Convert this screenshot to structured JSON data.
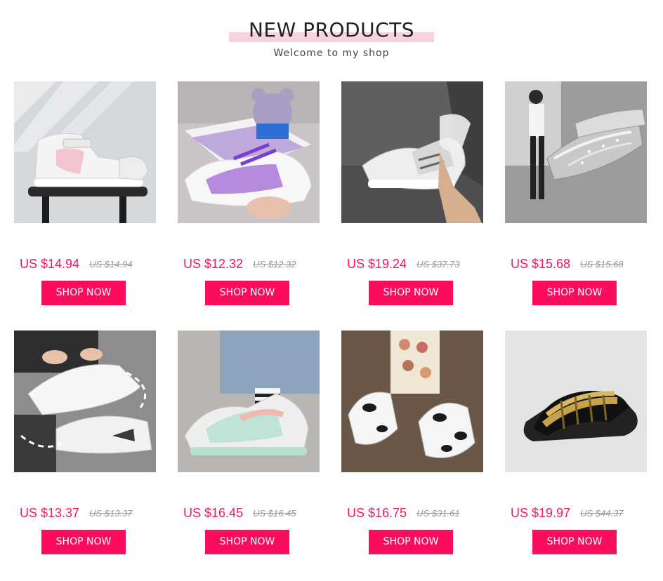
{
  "header": {
    "title": "NEW PRODUCTS",
    "subtitle": "Welcome to my shop"
  },
  "colors": {
    "price": "#ee1a5c",
    "button": "#fb0c5c",
    "title_highlight": "#f7d3e1"
  },
  "products": [
    {
      "image": "white-pink-high-top-sneaker",
      "price": "US $14.94",
      "old_price": "US $14.94",
      "button_label": "SHOP NOW"
    },
    {
      "image": "purple-painted-sneaker-with-plush-toy",
      "price": "US $12.32",
      "old_price": "US $12.32",
      "button_label": "SHOP NOW"
    },
    {
      "image": "white-reflective-sneaker",
      "price": "US $19.24",
      "old_price": "US $37.73",
      "button_label": "SHOP NOW"
    },
    {
      "image": "silver-glitter-sneaker",
      "price": "US $15.68",
      "old_price": "US $15.68",
      "button_label": "SHOP NOW"
    },
    {
      "image": "white-sneakers-in-hands",
      "price": "US $13.37",
      "old_price": "US $13.37",
      "button_label": "SHOP NOW"
    },
    {
      "image": "mint-pastel-sneaker",
      "price": "US $16.45",
      "old_price": "US $16.45",
      "button_label": "SHOP NOW"
    },
    {
      "image": "cow-print-sneakers",
      "price": "US $16.75",
      "old_price": "US $31.61",
      "button_label": "SHOP NOW"
    },
    {
      "image": "black-chain-slide-sandal",
      "price": "US $19.97",
      "old_price": "US $44.37",
      "button_label": "SHOP NOW"
    }
  ]
}
